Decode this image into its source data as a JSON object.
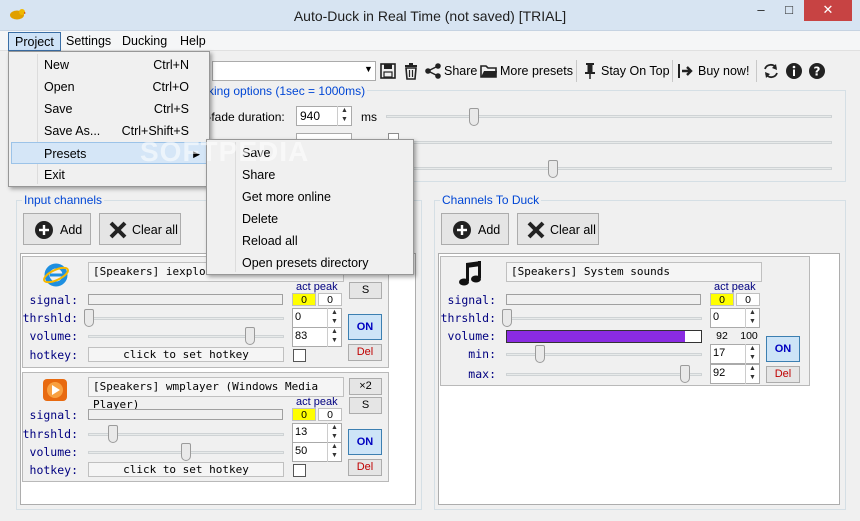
{
  "window": {
    "title": "Auto-Duck in Real Time (not saved) [TRIAL]",
    "min_glyph": "–",
    "max_glyph": "□",
    "close_glyph": "✕"
  },
  "menubar": {
    "project": "Project",
    "settings": "Settings",
    "ducking": "Ducking",
    "help": "Help"
  },
  "project_menu": [
    {
      "label": "New",
      "shortcut": "Ctrl+N"
    },
    {
      "label": "Open",
      "shortcut": "Ctrl+O"
    },
    {
      "label": "Save",
      "shortcut": "Ctrl+S"
    },
    {
      "label": "Save As...",
      "shortcut": "Ctrl+Shift+S"
    },
    {
      "label": "Presets",
      "shortcut": ""
    },
    {
      "label": "Exit",
      "shortcut": ""
    }
  ],
  "presets_submenu": [
    "Save",
    "Share",
    "Get more online",
    "Delete",
    "Reload all",
    "Open presets directory"
  ],
  "toolbar": {
    "share": "Share",
    "more_presets": "More presets",
    "stay_on_top": "Stay On Top",
    "buy_now": "Buy now!"
  },
  "ducking_options": {
    "title": "cking options (1sec = 1000ms)",
    "fade_label": "rt-fade duration:",
    "fade_value": "940",
    "fade_unit": "ms"
  },
  "watermark": "SOFTPEDIA",
  "input_channels": {
    "title": "Input channels",
    "add": "Add",
    "clear_all": "Clear all",
    "channels": [
      {
        "name": "[Speakers] iexplore",
        "count": "",
        "signal_label": "signal:",
        "thrshld_label": "thrshld:",
        "volume_label": "volume:",
        "hotkey_label": "hotkey:",
        "act_peak": "act peak",
        "act": "0",
        "peak": "0",
        "threshold": "0",
        "volume": "83",
        "hotkey_text": "click to set hotkey",
        "s": "S",
        "on": "ON",
        "del": "Del"
      },
      {
        "name": "[Speakers] wmplayer (Windows Media Player)",
        "count": "×2",
        "signal_label": "signal:",
        "thrshld_label": "thrshld:",
        "volume_label": "volume:",
        "hotkey_label": "hotkey:",
        "act_peak": "act peak",
        "act": "0",
        "peak": "0",
        "threshold": "13",
        "volume": "50",
        "hotkey_text": "click to set hotkey",
        "s": "S",
        "on": "ON",
        "del": "Del"
      }
    ]
  },
  "duck_channels": {
    "title": "Channels To Duck",
    "add": "Add",
    "clear_all": "Clear all",
    "channels": [
      {
        "name": "[Speakers] System sounds",
        "signal_label": "signal:",
        "thrshld_label": "thrshld:",
        "volume_label": "volume:",
        "min_label": "min:",
        "max_label": "max:",
        "act_peak": "act peak",
        "act": "0",
        "peak": "0",
        "threshold": "0",
        "volume_now": "92",
        "volume_max": "100",
        "min": "17",
        "max": "92",
        "on": "ON",
        "del": "Del"
      }
    ]
  },
  "colors": {
    "accent_blue": "#0046d5",
    "label_navy": "#000080",
    "volume_purple": "#8a2be2",
    "signal_yellow": "#ffff00",
    "del_red": "#c00000"
  }
}
